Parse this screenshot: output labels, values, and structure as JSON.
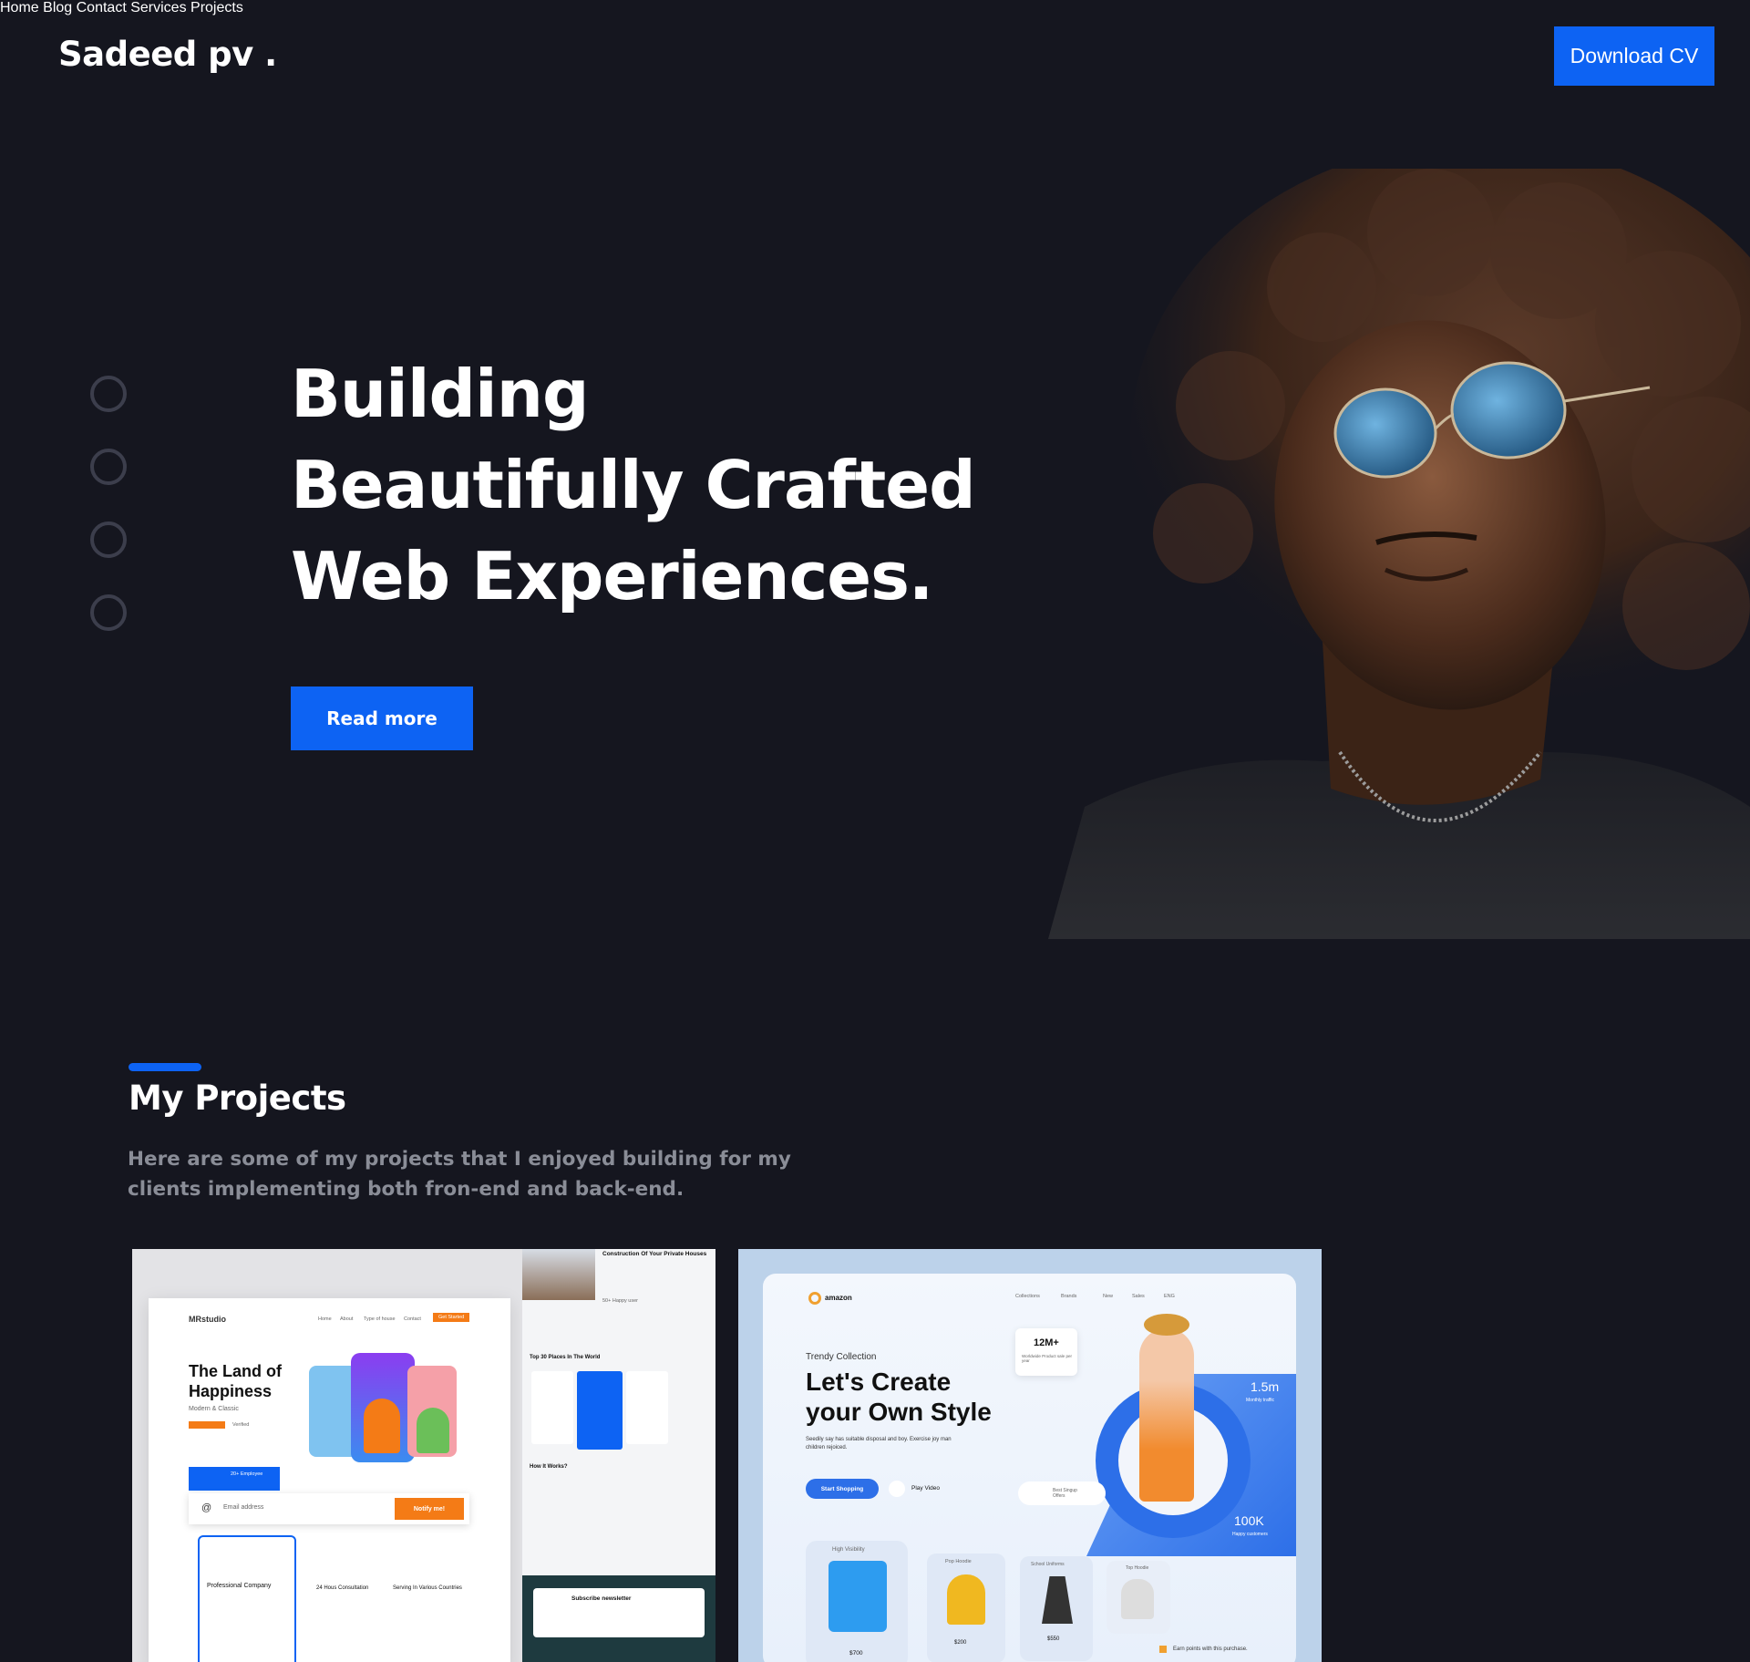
{
  "header": {
    "logo": "Sadeed pv .",
    "nav": [
      "Home",
      "Blog",
      "Contact",
      "Services",
      "Projects"
    ],
    "cta": "Download CV"
  },
  "hero": {
    "title_lines": [
      "Building",
      "Beautifully Crafted",
      "Web Experiences."
    ],
    "button": "Read more",
    "slider_dots": 4
  },
  "projects": {
    "title": "My Projects",
    "description": "Here are some of my projects that I enjoyed building for my clients implementing both fron-end and back-end.",
    "cards": [
      {
        "brand": "MRstudio",
        "nav": [
          "Home",
          "About",
          "Type of house",
          "Contact"
        ],
        "nav_button": "Get Started",
        "headline_1": "The Land of",
        "headline_2": "Happiness",
        "sub": "Modern & Classic",
        "badge": "Verified",
        "stat": "20+ Employee",
        "email_placeholder": "Email address",
        "notify": "Notify me!",
        "features": [
          "Professional Company",
          "24 Hous Consultation",
          "Serving In Various Countries"
        ],
        "side_title": "Construction Of Your Private Houses",
        "side_users": "50+ Happy user",
        "side_places": "Top 30 Places In The World",
        "side_how": "How It Works?",
        "newsletter": "Subscribe newsletter"
      },
      {
        "brand": "amazon",
        "nav": [
          "Collections",
          "Brands",
          "New",
          "Sales",
          "ENG"
        ],
        "kicker": "Trendy Collection",
        "headline_1": "Let's Create",
        "headline_2": "your Own Style",
        "body": "Seedily say has suitable disposal and boy. Exercise joy man children rejoiced.",
        "cta": "Start Shopping",
        "video": "Play Video",
        "stat_1": "12M+",
        "stat_1_label": "Worldwide Product sale per year",
        "stat_2": "1.5m",
        "stat_2_label": "Monthly traffic",
        "stat_3": "100K",
        "stat_3_label": "Happy customers",
        "offer": "Best Singup Offers",
        "products": [
          {
            "name": "High Visibility",
            "price": "$700"
          },
          {
            "name": "Pop Hoodie",
            "price": "$200"
          },
          {
            "name": "School Uniforms",
            "price": "$550"
          },
          {
            "name": "Top Hoodie",
            "price": ""
          }
        ],
        "earn": "Earn points with this purchase."
      }
    ]
  },
  "colors": {
    "background": "#15161f",
    "accent": "#0d63f3",
    "muted": "#8a8d97",
    "orange": "#f47b16"
  }
}
